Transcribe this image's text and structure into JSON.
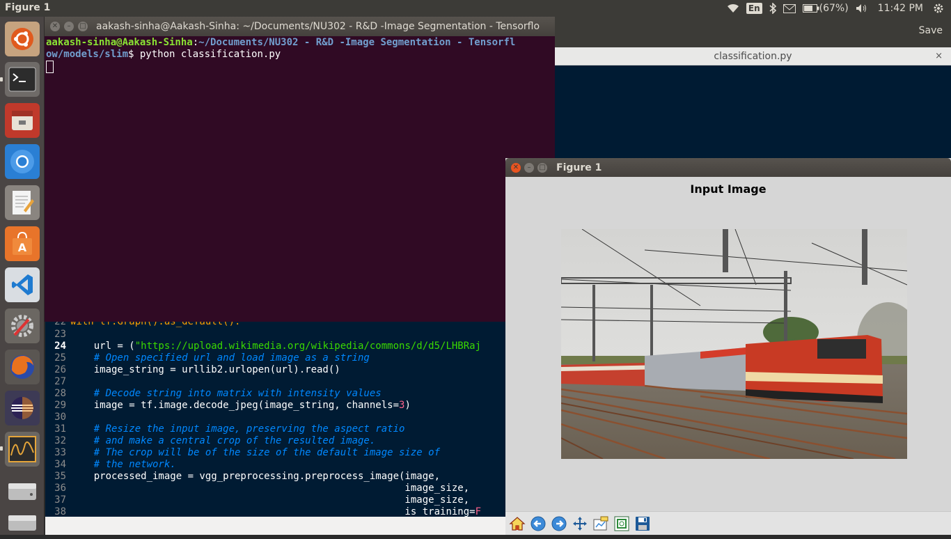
{
  "top_panel": {
    "app_title": "Figure 1",
    "language": "En",
    "battery": "(67%)",
    "clock": "11:42 PM"
  },
  "launcher": {
    "items": [
      "ubuntu-dash-icon",
      "terminal-icon",
      "files-icon",
      "chromium-icon",
      "text-editor-icon",
      "software-center-icon",
      "vscode-icon",
      "system-settings-icon",
      "firefox-icon",
      "eclipse-icon",
      "system-monitor-icon",
      "disk-drive-icon",
      "removable-drive-icon"
    ]
  },
  "terminal": {
    "title": "aakash-sinha@Aakash-Sinha: ~/Documents/NU302 - R&D -Image Segmentation - Tensorflo",
    "prompt_user": "aakash-sinha@Aakash-Sinha",
    "prompt_path_1": "~/Documents/NU302 - R&D -Image Segmentation - Tensorfl",
    "prompt_path_2": "ow/models/slim",
    "prompt_symbol": "$",
    "command": " python classification.py"
  },
  "gedit": {
    "save_label": "Save",
    "tab_label": "classification.py",
    "tab_close": "×"
  },
  "code": {
    "partial_line": "with tf.Graph().as_default():",
    "partial_ln": "22",
    "lines": [
      {
        "ln": "23",
        "parts": []
      },
      {
        "ln": "24",
        "current": true,
        "parts": [
          [
            "",
            "    url = ("
          ],
          [
            "c-str",
            "\"https://upload.wikimedia.org/wikipedia/commons/d/d5/LHBRaj"
          ]
        ]
      },
      {
        "ln": "25",
        "parts": [
          [
            "c-com",
            "    # Open specified url and load image as a string"
          ]
        ]
      },
      {
        "ln": "26",
        "parts": [
          [
            "",
            "    image_string = urllib2.urlopen(url).read()"
          ]
        ]
      },
      {
        "ln": "27",
        "parts": []
      },
      {
        "ln": "28",
        "parts": [
          [
            "c-com",
            "    # Decode string into matrix with intensity values"
          ]
        ]
      },
      {
        "ln": "29",
        "parts": [
          [
            "",
            "    image = tf.image.decode_jpeg(image_string, channels="
          ],
          [
            "c-num",
            "3"
          ],
          [
            "",
            ")"
          ]
        ]
      },
      {
        "ln": "30",
        "parts": []
      },
      {
        "ln": "31",
        "parts": [
          [
            "c-com",
            "    # Resize the input image, preserving the aspect ratio"
          ]
        ]
      },
      {
        "ln": "32",
        "parts": [
          [
            "c-com",
            "    # and make a central crop of the resulted image."
          ]
        ]
      },
      {
        "ln": "33",
        "parts": [
          [
            "c-com",
            "    # The crop will be of the size of the default image size of"
          ]
        ]
      },
      {
        "ln": "34",
        "parts": [
          [
            "c-com",
            "    # the network."
          ]
        ]
      },
      {
        "ln": "35",
        "parts": [
          [
            "",
            "    processed_image = vgg_preprocessing.preprocess_image(image,"
          ]
        ]
      },
      {
        "ln": "36",
        "parts": [
          [
            "",
            "                                                         image_size,"
          ]
        ]
      },
      {
        "ln": "37",
        "parts": [
          [
            "",
            "                                                         image_size,"
          ]
        ]
      },
      {
        "ln": "38",
        "parts": [
          [
            "",
            "                                                         is_training="
          ],
          [
            "c-num",
            "F"
          ]
        ]
      }
    ]
  },
  "figure": {
    "window_title": "Figure 1",
    "plot_title": "Input Image",
    "toolbar": [
      "home-icon",
      "back-icon",
      "forward-icon",
      "pan-icon",
      "configure-subplots-icon",
      "zoom-icon",
      "save-figure-icon"
    ]
  },
  "colors": {
    "terminal_bg": "#300a24",
    "editor_bg": "#001b33",
    "panel_bg": "#3c3b37",
    "launcher_bg": "#4a4544",
    "close_button": "#e95420"
  }
}
